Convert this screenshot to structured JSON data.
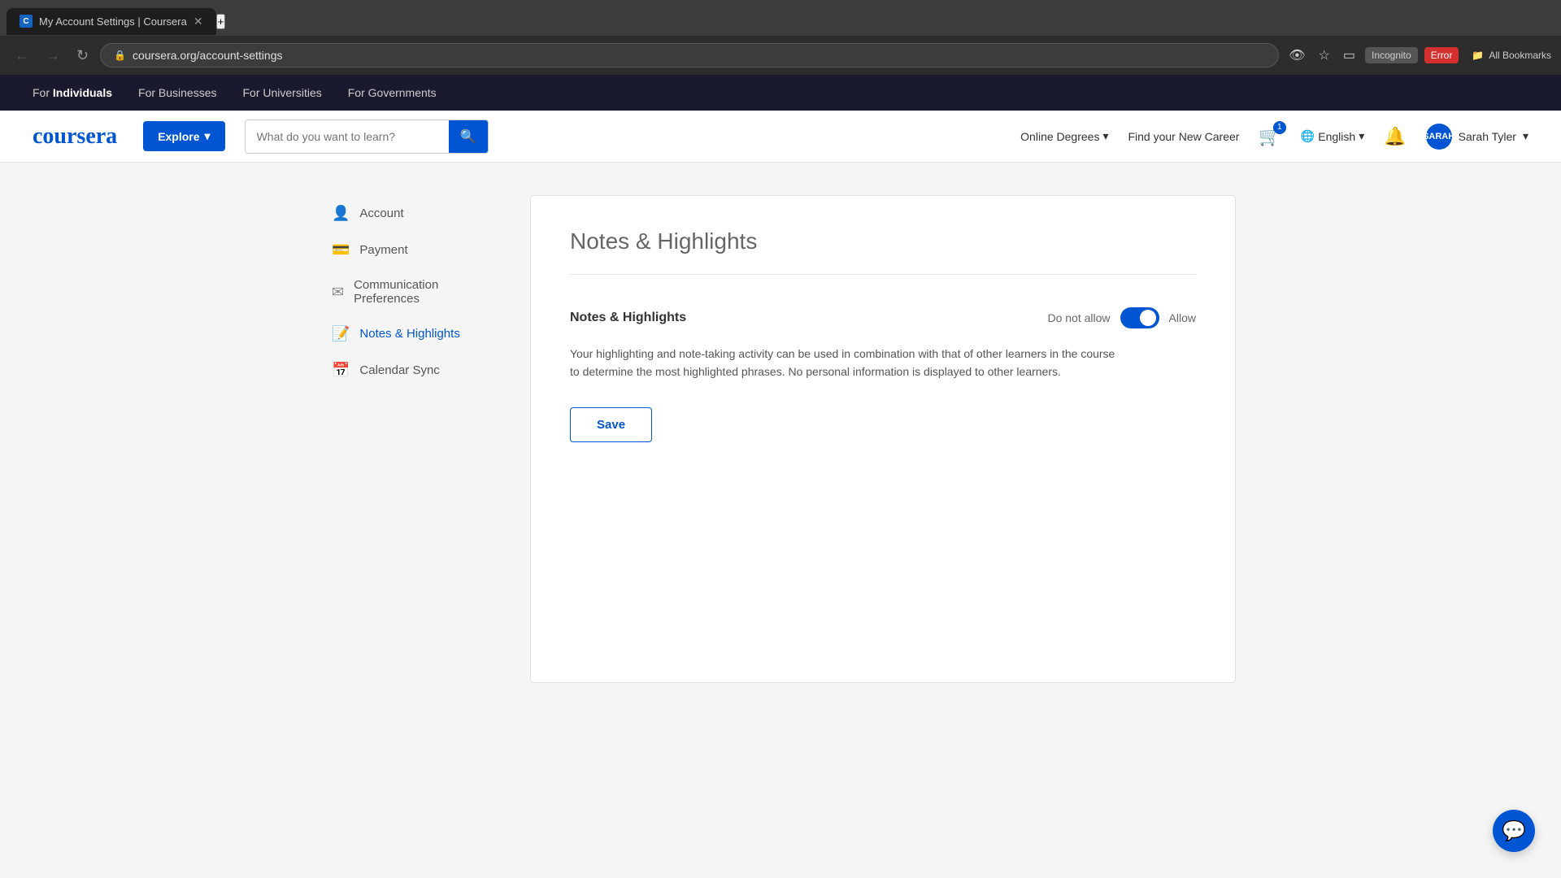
{
  "browser": {
    "tab_title": "My Account Settings | Coursera",
    "tab_favicon": "C",
    "address": "coursera.org/account-settings",
    "incognito_label": "Incognito",
    "error_label": "Error",
    "bookmarks_label": "All Bookmarks"
  },
  "top_nav": {
    "for_individuals_pre": "For ",
    "for_individuals_bold": "Individuals",
    "for_businesses": "For Businesses",
    "for_universities": "For Universities",
    "for_governments": "For Governments"
  },
  "main_nav": {
    "logo": "coursera",
    "explore_label": "Explore",
    "search_placeholder": "What do you want to learn?",
    "online_degrees": "Online Degrees",
    "find_career": "Find your New Career",
    "cart_count": "1",
    "language": "English",
    "user_initials": "SARAH",
    "user_name": "Sarah Tyler"
  },
  "sidebar": {
    "items": [
      {
        "id": "account",
        "label": "Account",
        "icon": "person"
      },
      {
        "id": "payment",
        "label": "Payment",
        "icon": "payment"
      },
      {
        "id": "communication",
        "label": "Communication Preferences",
        "icon": "email"
      },
      {
        "id": "notes",
        "label": "Notes & Highlights",
        "icon": "notes",
        "active": true
      },
      {
        "id": "calendar",
        "label": "Calendar Sync",
        "icon": "calendar"
      }
    ]
  },
  "content": {
    "page_title": "Notes & Highlights",
    "setting_label": "Notes & Highlights",
    "do_not_allow_text": "Do not allow",
    "allow_text": "Allow",
    "toggle_on": true,
    "description": "Your highlighting and note-taking activity can be used in combination with that of other learners in the course to determine the most highlighted phrases. No personal information is displayed to other learners.",
    "save_button": "Save"
  }
}
